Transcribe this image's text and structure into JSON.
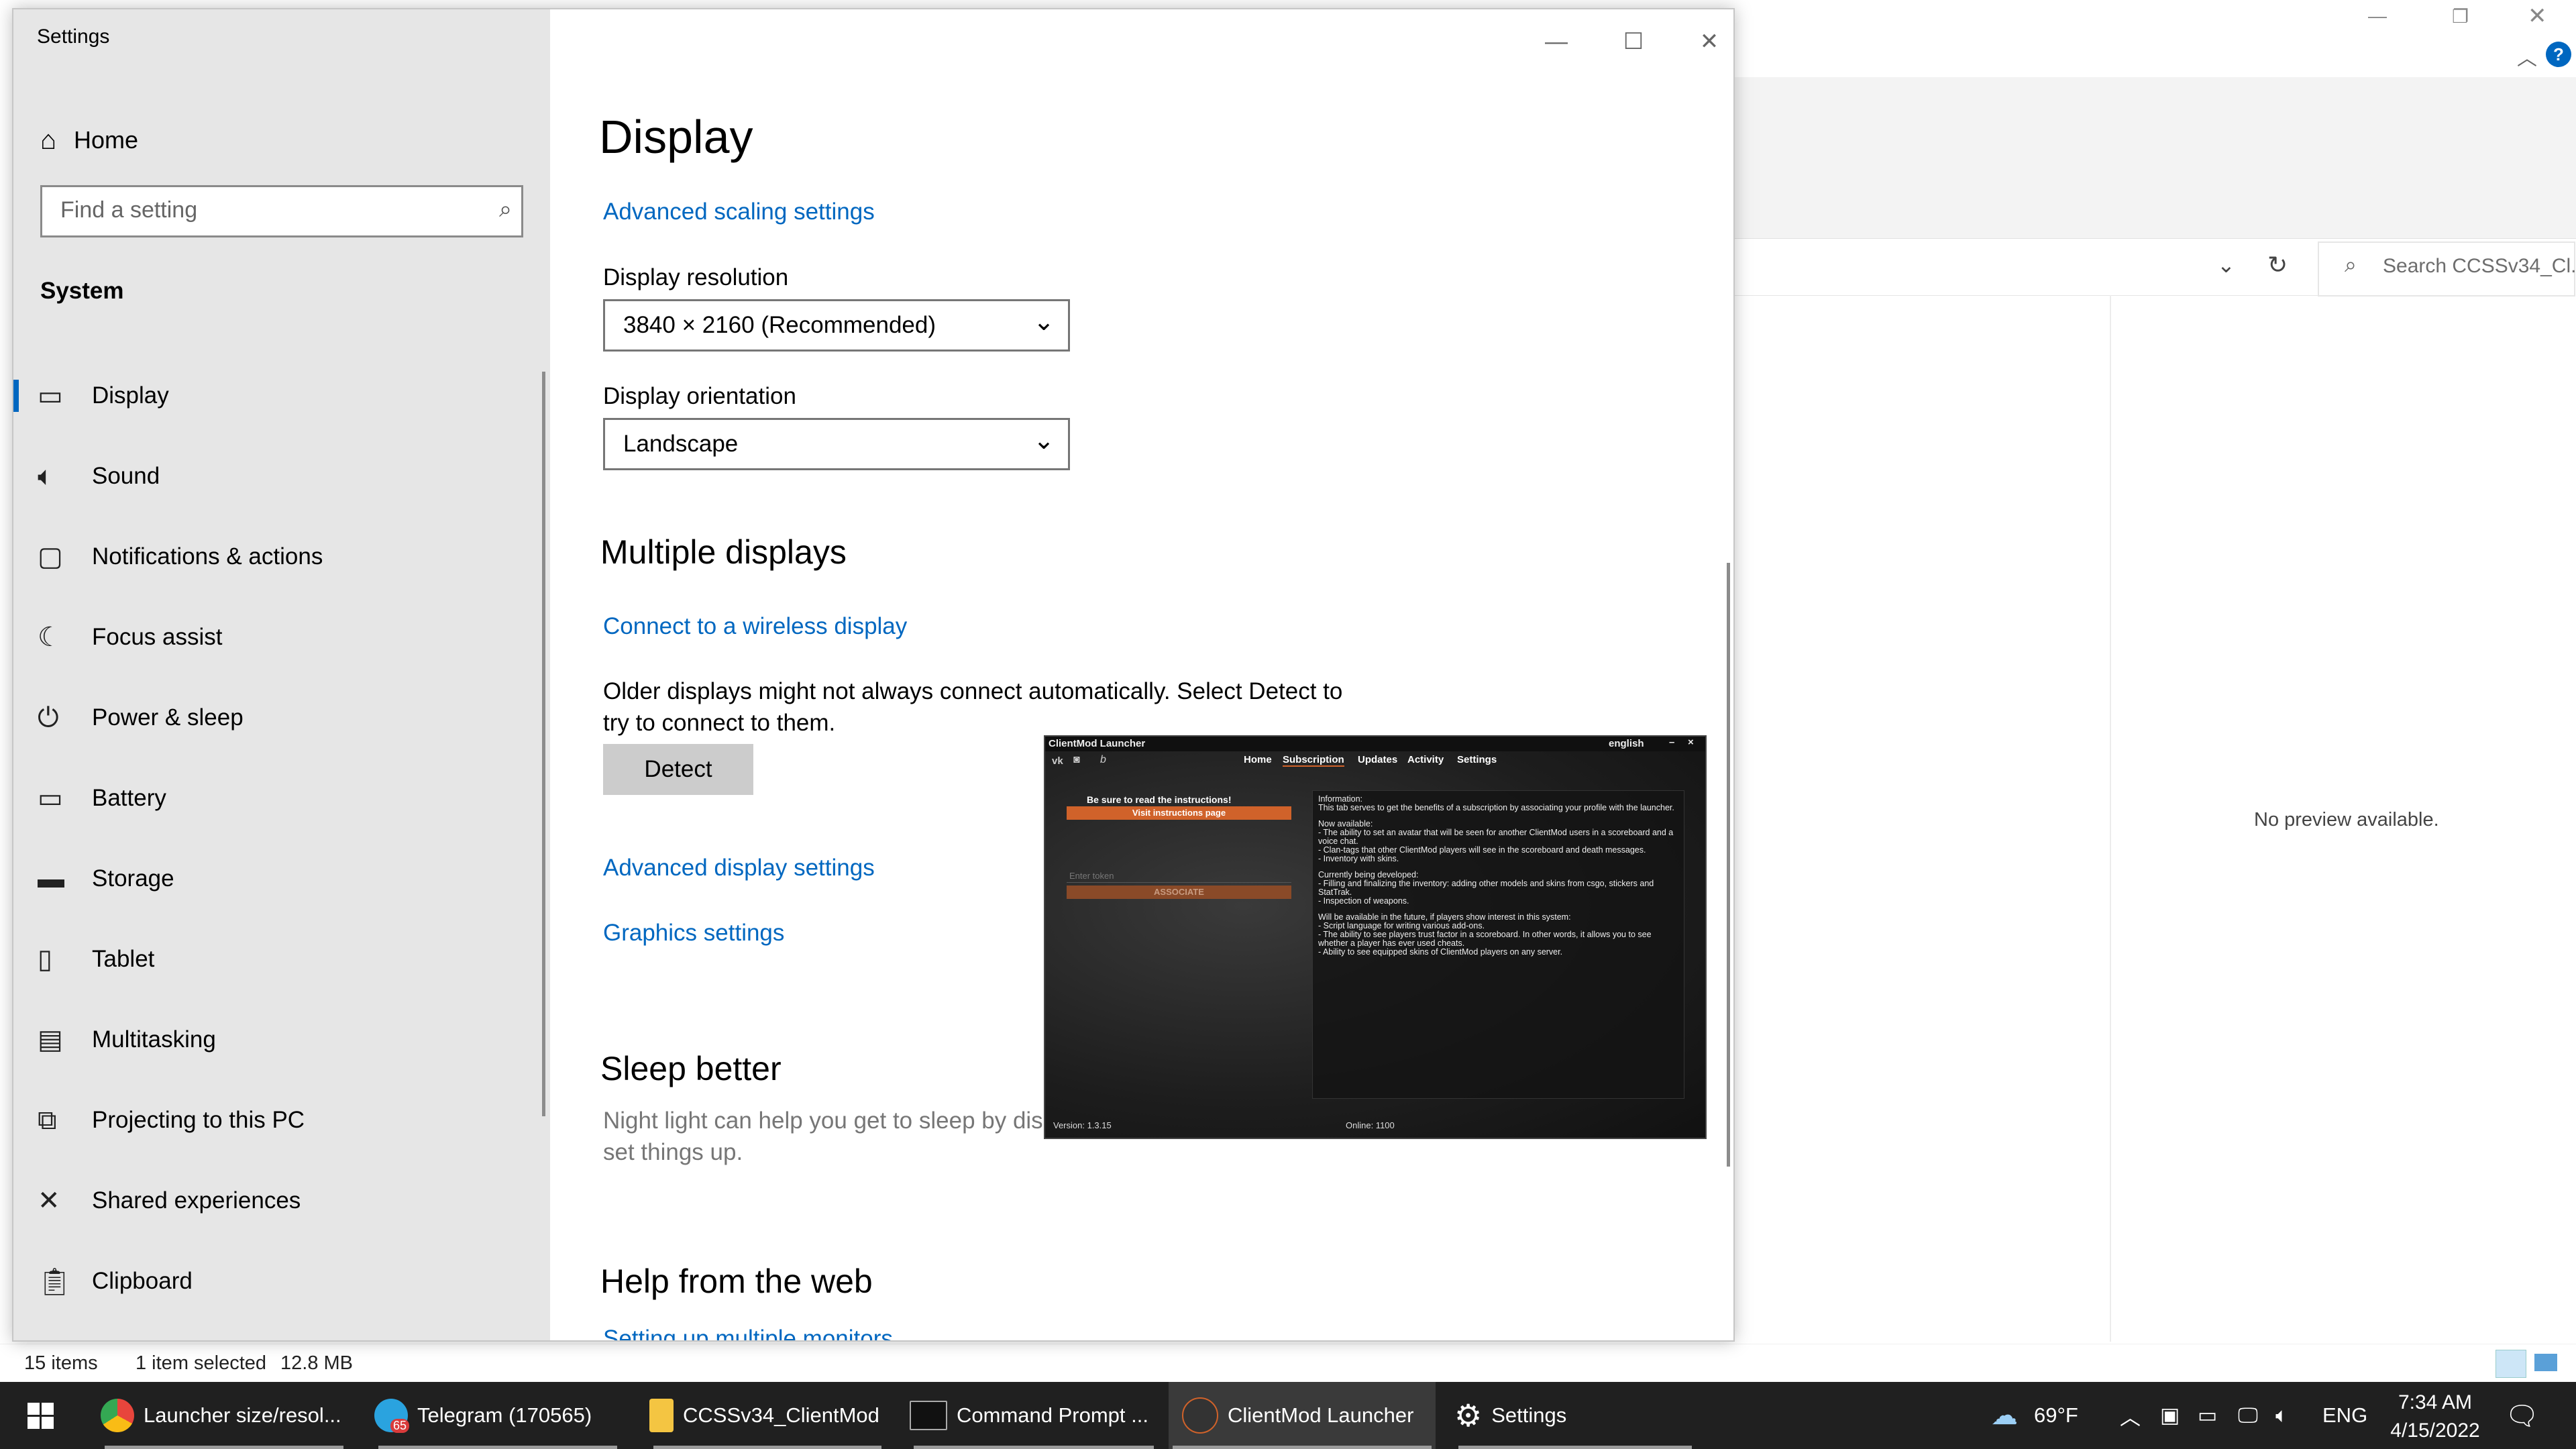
{
  "explorer": {
    "search_placeholder": "Search CCSSv34_Cl...",
    "no_preview": "No preview available.",
    "status_items": "15 items",
    "status_selected": "1 item selected",
    "status_size": "12.8 MB"
  },
  "settings": {
    "window_title": "Settings",
    "home_label": "Home",
    "search_placeholder": "Find a setting",
    "section": "System",
    "nav": [
      {
        "label": "Display",
        "icon": "monitor-icon",
        "active": true
      },
      {
        "label": "Sound",
        "icon": "speaker-icon"
      },
      {
        "label": "Notifications & actions",
        "icon": "notification-icon"
      },
      {
        "label": "Focus assist",
        "icon": "moon-icon"
      },
      {
        "label": "Power & sleep",
        "icon": "power-icon"
      },
      {
        "label": "Battery",
        "icon": "battery-icon"
      },
      {
        "label": "Storage",
        "icon": "storage-icon"
      },
      {
        "label": "Tablet",
        "icon": "tablet-icon"
      },
      {
        "label": "Multitasking",
        "icon": "multitasking-icon"
      },
      {
        "label": "Projecting to this PC",
        "icon": "projecting-icon"
      },
      {
        "label": "Shared experiences",
        "icon": "shared-icon"
      },
      {
        "label": "Clipboard",
        "icon": "clipboard-icon"
      }
    ],
    "main": {
      "title": "Display",
      "advanced_scaling": "Advanced scaling settings",
      "resolution_label": "Display resolution",
      "resolution_value": "3840 × 2160 (Recommended)",
      "orientation_label": "Display orientation",
      "orientation_value": "Landscape",
      "multiple_displays": "Multiple displays",
      "connect_wireless": "Connect to a wireless display",
      "older_displays_line1": "Older displays might not always connect automatically. Select Detect to",
      "older_displays_line2": "try to connect to them.",
      "detect": "Detect",
      "advanced_display": "Advanced display settings",
      "graphics": "Graphics settings",
      "sleep_better": "Sleep better",
      "night_light_line1": "Night light can help you get to sleep by disp",
      "night_light_line2": "set things up.",
      "help_web": "Help from the web",
      "setup_monitors": "Setting up multiple monitors"
    }
  },
  "launcher": {
    "title": "ClientMod Launcher",
    "language": "english",
    "nav": [
      "Home",
      "Subscription",
      "Updates",
      "Activity",
      "Settings"
    ],
    "instructions_heading": "Be sure to read the instructions!",
    "instructions_button": "Visit instructions page",
    "token_placeholder": "Enter token",
    "associate_button": "ASSOCIATE",
    "info": [
      "Information:\nThis tab serves to get the benefits of a subscription by associating your profile with the launcher.",
      "Now available:\n- The ability to set an avatar that will be seen for another ClientMod users in a scoreboard and a voice chat.\n- Clan-tags that other ClientMod players will see in the scoreboard and death messages.\n- Inventory with skins.",
      "Currently being developed:\n- Filling and finalizing the inventory: adding other models and skins from csgo, stickers and StatTrak.\n- Inspection of weapons.",
      "Will be available in the future, if players show interest in this system:\n- Script language for writing various add-ons.\n- The ability to see players trust factor in a scoreboard. In other words, it allows you to see whether a player has ever used cheats.\n- Ability to see equipped skins of ClientMod players on any server."
    ],
    "version": "Version: 1.3.15",
    "online": "Online: 1100"
  },
  "taskbar": {
    "items": [
      {
        "label": "Launcher size/resol...",
        "icon": "chrome-icon",
        "color": "#e8453c"
      },
      {
        "label": "Telegram (170565)",
        "icon": "telegram-icon",
        "color": "#2aa3df",
        "badge": "65"
      },
      {
        "label": "CCSSv34_ClientMod",
        "icon": "folder-icon",
        "color": "#f4c542"
      },
      {
        "label": "Command Prompt ...",
        "icon": "cmd-icon",
        "color": "#111111"
      },
      {
        "label": "ClientMod Launcher",
        "icon": "clientmod-icon",
        "color": "#333333"
      },
      {
        "label": "Settings",
        "icon": "gear-icon",
        "color": "#ffffff"
      }
    ],
    "weather": "69°F",
    "language": "ENG",
    "time": "7:34 AM",
    "date": "4/15/2022"
  },
  "colors": {
    "accent": "#0067c0",
    "taskbar": "#202020",
    "sidebar": "#e6e6e6",
    "launcher_orange": "#d0622a"
  }
}
